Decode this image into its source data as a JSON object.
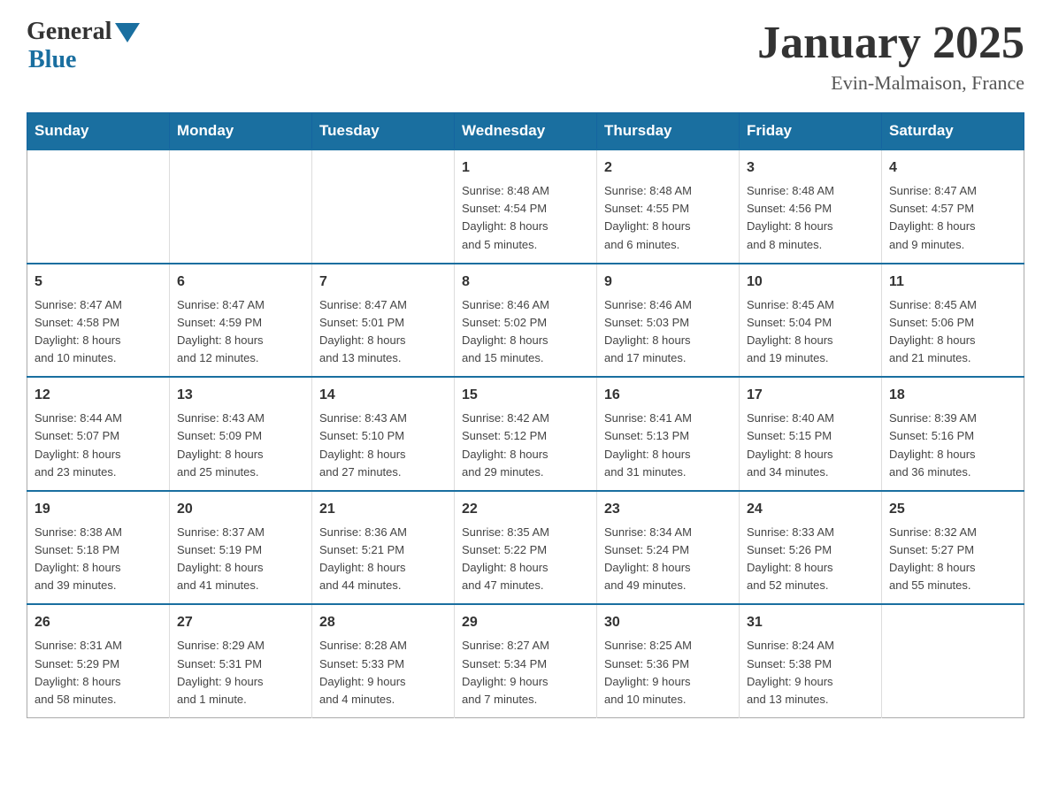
{
  "header": {
    "logo_general": "General",
    "logo_blue": "Blue",
    "title": "January 2025",
    "subtitle": "Evin-Malmaison, France"
  },
  "days_of_week": [
    "Sunday",
    "Monday",
    "Tuesday",
    "Wednesday",
    "Thursday",
    "Friday",
    "Saturday"
  ],
  "weeks": [
    [
      {
        "day": "",
        "info": ""
      },
      {
        "day": "",
        "info": ""
      },
      {
        "day": "",
        "info": ""
      },
      {
        "day": "1",
        "info": "Sunrise: 8:48 AM\nSunset: 4:54 PM\nDaylight: 8 hours\nand 5 minutes."
      },
      {
        "day": "2",
        "info": "Sunrise: 8:48 AM\nSunset: 4:55 PM\nDaylight: 8 hours\nand 6 minutes."
      },
      {
        "day": "3",
        "info": "Sunrise: 8:48 AM\nSunset: 4:56 PM\nDaylight: 8 hours\nand 8 minutes."
      },
      {
        "day": "4",
        "info": "Sunrise: 8:47 AM\nSunset: 4:57 PM\nDaylight: 8 hours\nand 9 minutes."
      }
    ],
    [
      {
        "day": "5",
        "info": "Sunrise: 8:47 AM\nSunset: 4:58 PM\nDaylight: 8 hours\nand 10 minutes."
      },
      {
        "day": "6",
        "info": "Sunrise: 8:47 AM\nSunset: 4:59 PM\nDaylight: 8 hours\nand 12 minutes."
      },
      {
        "day": "7",
        "info": "Sunrise: 8:47 AM\nSunset: 5:01 PM\nDaylight: 8 hours\nand 13 minutes."
      },
      {
        "day": "8",
        "info": "Sunrise: 8:46 AM\nSunset: 5:02 PM\nDaylight: 8 hours\nand 15 minutes."
      },
      {
        "day": "9",
        "info": "Sunrise: 8:46 AM\nSunset: 5:03 PM\nDaylight: 8 hours\nand 17 minutes."
      },
      {
        "day": "10",
        "info": "Sunrise: 8:45 AM\nSunset: 5:04 PM\nDaylight: 8 hours\nand 19 minutes."
      },
      {
        "day": "11",
        "info": "Sunrise: 8:45 AM\nSunset: 5:06 PM\nDaylight: 8 hours\nand 21 minutes."
      }
    ],
    [
      {
        "day": "12",
        "info": "Sunrise: 8:44 AM\nSunset: 5:07 PM\nDaylight: 8 hours\nand 23 minutes."
      },
      {
        "day": "13",
        "info": "Sunrise: 8:43 AM\nSunset: 5:09 PM\nDaylight: 8 hours\nand 25 minutes."
      },
      {
        "day": "14",
        "info": "Sunrise: 8:43 AM\nSunset: 5:10 PM\nDaylight: 8 hours\nand 27 minutes."
      },
      {
        "day": "15",
        "info": "Sunrise: 8:42 AM\nSunset: 5:12 PM\nDaylight: 8 hours\nand 29 minutes."
      },
      {
        "day": "16",
        "info": "Sunrise: 8:41 AM\nSunset: 5:13 PM\nDaylight: 8 hours\nand 31 minutes."
      },
      {
        "day": "17",
        "info": "Sunrise: 8:40 AM\nSunset: 5:15 PM\nDaylight: 8 hours\nand 34 minutes."
      },
      {
        "day": "18",
        "info": "Sunrise: 8:39 AM\nSunset: 5:16 PM\nDaylight: 8 hours\nand 36 minutes."
      }
    ],
    [
      {
        "day": "19",
        "info": "Sunrise: 8:38 AM\nSunset: 5:18 PM\nDaylight: 8 hours\nand 39 minutes."
      },
      {
        "day": "20",
        "info": "Sunrise: 8:37 AM\nSunset: 5:19 PM\nDaylight: 8 hours\nand 41 minutes."
      },
      {
        "day": "21",
        "info": "Sunrise: 8:36 AM\nSunset: 5:21 PM\nDaylight: 8 hours\nand 44 minutes."
      },
      {
        "day": "22",
        "info": "Sunrise: 8:35 AM\nSunset: 5:22 PM\nDaylight: 8 hours\nand 47 minutes."
      },
      {
        "day": "23",
        "info": "Sunrise: 8:34 AM\nSunset: 5:24 PM\nDaylight: 8 hours\nand 49 minutes."
      },
      {
        "day": "24",
        "info": "Sunrise: 8:33 AM\nSunset: 5:26 PM\nDaylight: 8 hours\nand 52 minutes."
      },
      {
        "day": "25",
        "info": "Sunrise: 8:32 AM\nSunset: 5:27 PM\nDaylight: 8 hours\nand 55 minutes."
      }
    ],
    [
      {
        "day": "26",
        "info": "Sunrise: 8:31 AM\nSunset: 5:29 PM\nDaylight: 8 hours\nand 58 minutes."
      },
      {
        "day": "27",
        "info": "Sunrise: 8:29 AM\nSunset: 5:31 PM\nDaylight: 9 hours\nand 1 minute."
      },
      {
        "day": "28",
        "info": "Sunrise: 8:28 AM\nSunset: 5:33 PM\nDaylight: 9 hours\nand 4 minutes."
      },
      {
        "day": "29",
        "info": "Sunrise: 8:27 AM\nSunset: 5:34 PM\nDaylight: 9 hours\nand 7 minutes."
      },
      {
        "day": "30",
        "info": "Sunrise: 8:25 AM\nSunset: 5:36 PM\nDaylight: 9 hours\nand 10 minutes."
      },
      {
        "day": "31",
        "info": "Sunrise: 8:24 AM\nSunset: 5:38 PM\nDaylight: 9 hours\nand 13 minutes."
      },
      {
        "day": "",
        "info": ""
      }
    ]
  ]
}
